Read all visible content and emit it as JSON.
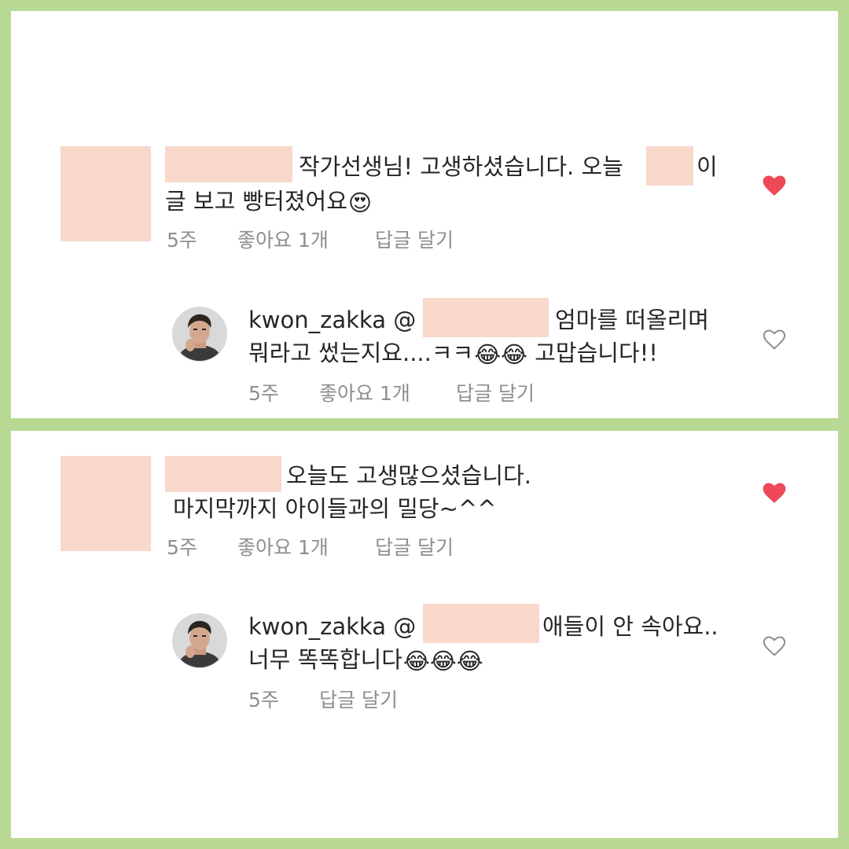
{
  "comments": [
    {
      "text_part1": "작가선생님! 고생하셨습니다. 오늘",
      "text_part2": "이",
      "text_line2": "글 보고 빵터졌어요",
      "emoji_line2": "😍",
      "time": "5주",
      "likes": "좋아요 1개",
      "reply_label": "답글 달기",
      "liked": true,
      "reply": {
        "username": "kwon_zakka",
        "mention_prefix": "@",
        "text_part1": "엄마를 떠올리며",
        "text_line2": "뭐라고 썼는지요....ㅋㅋ",
        "emoji_line2": "😂😂",
        "text_line2_end": "고맙습니다!!",
        "time": "5주",
        "likes": "좋아요 1개",
        "reply_label": "답글 달기",
        "liked": false
      }
    },
    {
      "text_part1": "오늘도 고생많으셨습니다.",
      "text_line2": "마지막까지 아이들과의 밀당~^^",
      "time": "5주",
      "likes": "좋아요 1개",
      "reply_label": "답글 달기",
      "liked": true,
      "reply": {
        "username": "kwon_zakka",
        "mention_prefix": "@",
        "text_part1": "애들이 안 속아요..",
        "text_line2": "너무 똑똑합니다",
        "emoji_line2": "😂😂😂",
        "time": "5주",
        "reply_label": "답글 달기",
        "liked": false
      }
    }
  ],
  "colors": {
    "frame": "#b8d993",
    "redaction": "#f7d8cb",
    "heart_liked": "#ed4956",
    "heart_outline": "#8e8e8e",
    "meta_text": "#8e8e8e"
  }
}
